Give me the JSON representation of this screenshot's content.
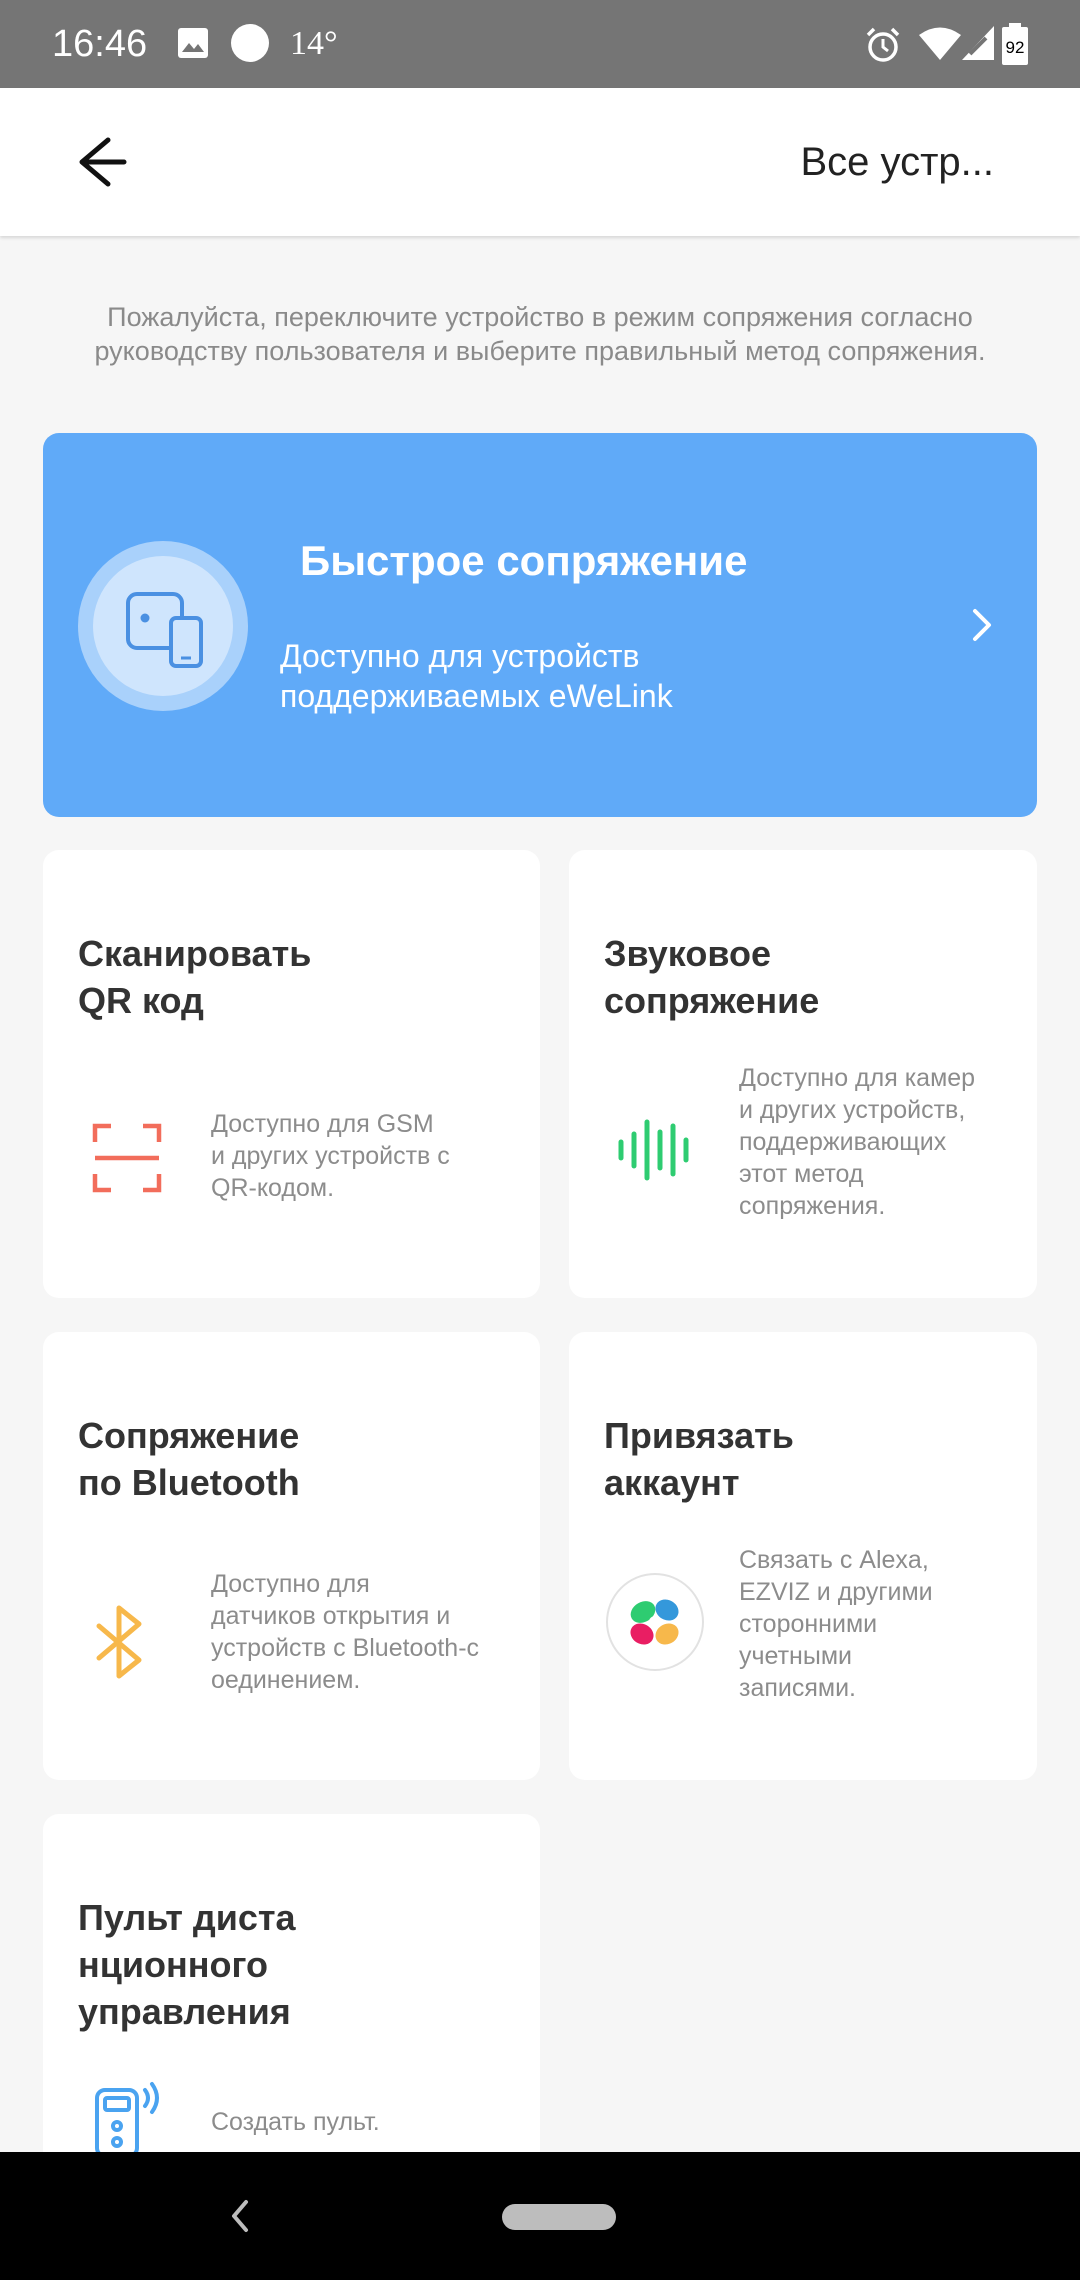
{
  "status_bar": {
    "time": "16:46",
    "temperature": "14°",
    "battery": "92",
    "icons": [
      "image-icon",
      "circle-icon",
      "alarm-icon",
      "wifi-icon",
      "signal-icon",
      "battery-icon"
    ]
  },
  "header": {
    "back_icon": "arrow-left-icon",
    "right_link": "Все устр..."
  },
  "intro": {
    "line1": "Пожалуйста, переключите устройство в режим сопряжения согласно",
    "line2": "руководству пользователя и выберите правильный метод сопряжения."
  },
  "quick_pairing": {
    "title": "Быстрое сопряжение",
    "desc_line1": "Доступно для устройств",
    "desc_line2": "поддерживаемых eWeLink",
    "icon": "devices-icon",
    "color": "#60aaf8"
  },
  "cards": {
    "qr": {
      "title_line1": "Сканировать",
      "title_line2": "QR код",
      "desc": [
        "Доступно для GSM",
        "и других устройств с",
        "QR-кодом."
      ],
      "icon": "qr-scan-icon",
      "color": "#f26d5b"
    },
    "sound": {
      "title_line1": "Звуковое",
      "title_line2": "сопряжение",
      "desc": [
        "Доступно для камер",
        "и других устройств,",
        "поддерживающих",
        "этот метод",
        "сопряжения."
      ],
      "icon": "sound-wave-icon",
      "color": "#2ecc71"
    },
    "bluetooth": {
      "title_line1": "Сопряжение",
      "title_line2": "по Bluetooth",
      "desc": [
        "Доступно для",
        "датчиков открытия и",
        "устройств с Bluetooth-с",
        "оединением."
      ],
      "icon": "bluetooth-icon",
      "color": "#f7b84b"
    },
    "account": {
      "title_line1": "Привязать",
      "title_line2": "аккаунт",
      "desc": [
        "Связать с Alexa,",
        "EZVIZ и другими",
        "сторонними",
        "учетными",
        "записями."
      ],
      "icon": "account-link-icon"
    },
    "remote": {
      "title_line1": "Пульт диста",
      "title_line2": "нционного",
      "title_line3": "управления",
      "desc": [
        "Создать пульт."
      ],
      "icon": "remote-control-icon",
      "color": "#4aa3f0"
    }
  },
  "nav": {
    "back_icon": "nav-back-icon",
    "home_icon": "nav-home-pill"
  }
}
